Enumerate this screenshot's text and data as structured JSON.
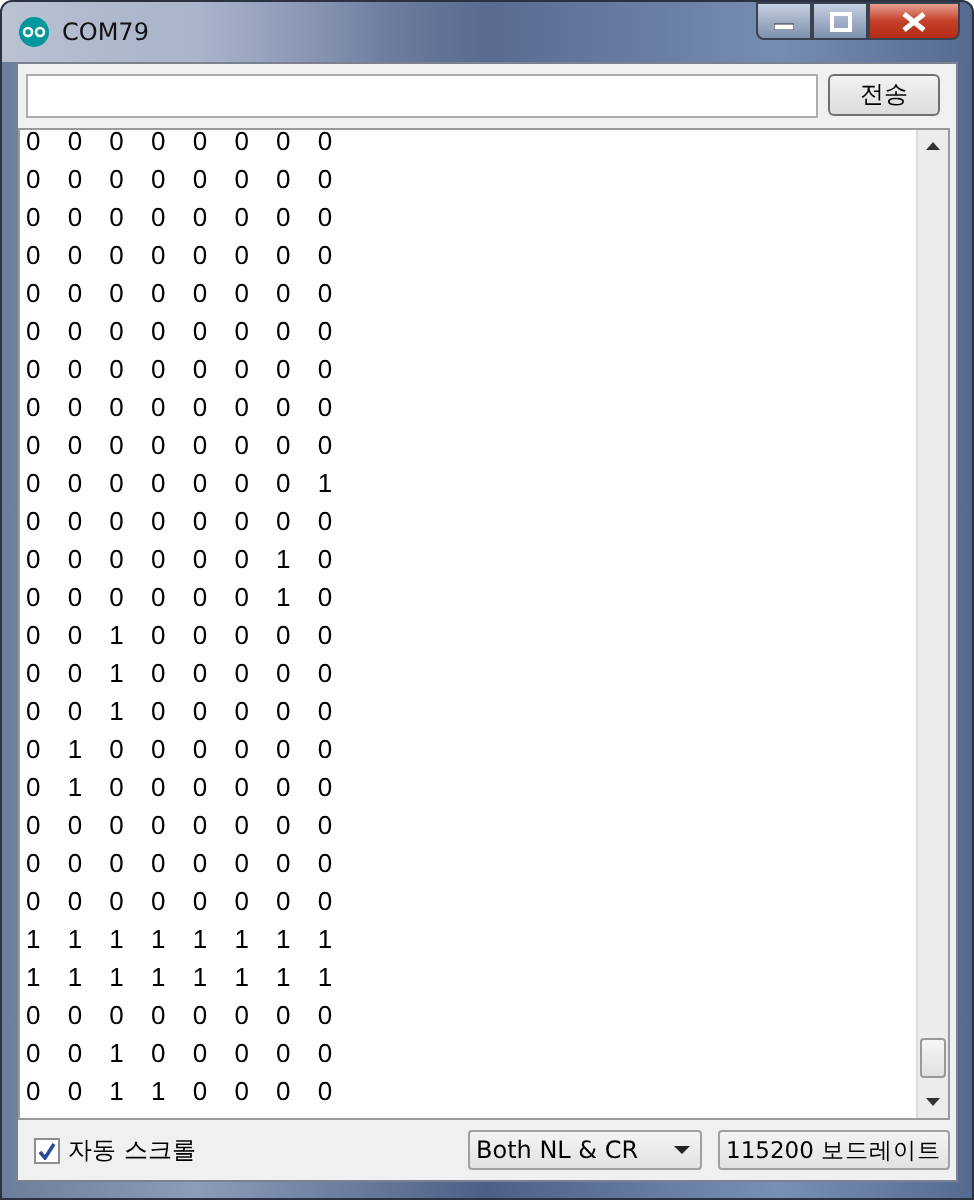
{
  "window": {
    "title": "COM79"
  },
  "send_button": {
    "label": "전송"
  },
  "output_lines": [
    "0 0 0 0 0 0 0 0",
    "0 0 0 0 0 0 0 0",
    "0 0 0 0 0 0 0 0",
    "0 0 0 0 0 0 0 0",
    "0 0 0 0 0 0 0 0",
    "0 0 0 0 0 0 0 0",
    "0 0 0 0 0 0 0 0",
    "0 0 0 0 0 0 0 0",
    "0 0 0 0 0 0 0 0",
    "0 0 0 0 0 0 0 1",
    "0 0 0 0 0 0 0 0",
    "0 0 0 0 0 0 1 0",
    "0 0 0 0 0 0 1 0",
    "0 0 1 0 0 0 0 0",
    "0 0 1 0 0 0 0 0",
    "0 0 1 0 0 0 0 0",
    "0 1 0 0 0 0 0 0",
    "0 1 0 0 0 0 0 0",
    "0 0 0 0 0 0 0 0",
    "0 0 0 0 0 0 0 0",
    "0 0 0 0 0 0 0 0",
    "1 1 1 1 1 1 1 1",
    "1 1 1 1 1 1 1 1",
    "0 0 0 0 0 0 0 0",
    "0 0 1 0 0 0 0 0",
    "0 0 1 1 0 0 0 0"
  ],
  "autoscroll": {
    "label": "자동 스크롤",
    "checked": true
  },
  "line_ending": {
    "value": "Both NL & CR"
  },
  "baud_rate": {
    "value": "115200 보드레이트"
  }
}
